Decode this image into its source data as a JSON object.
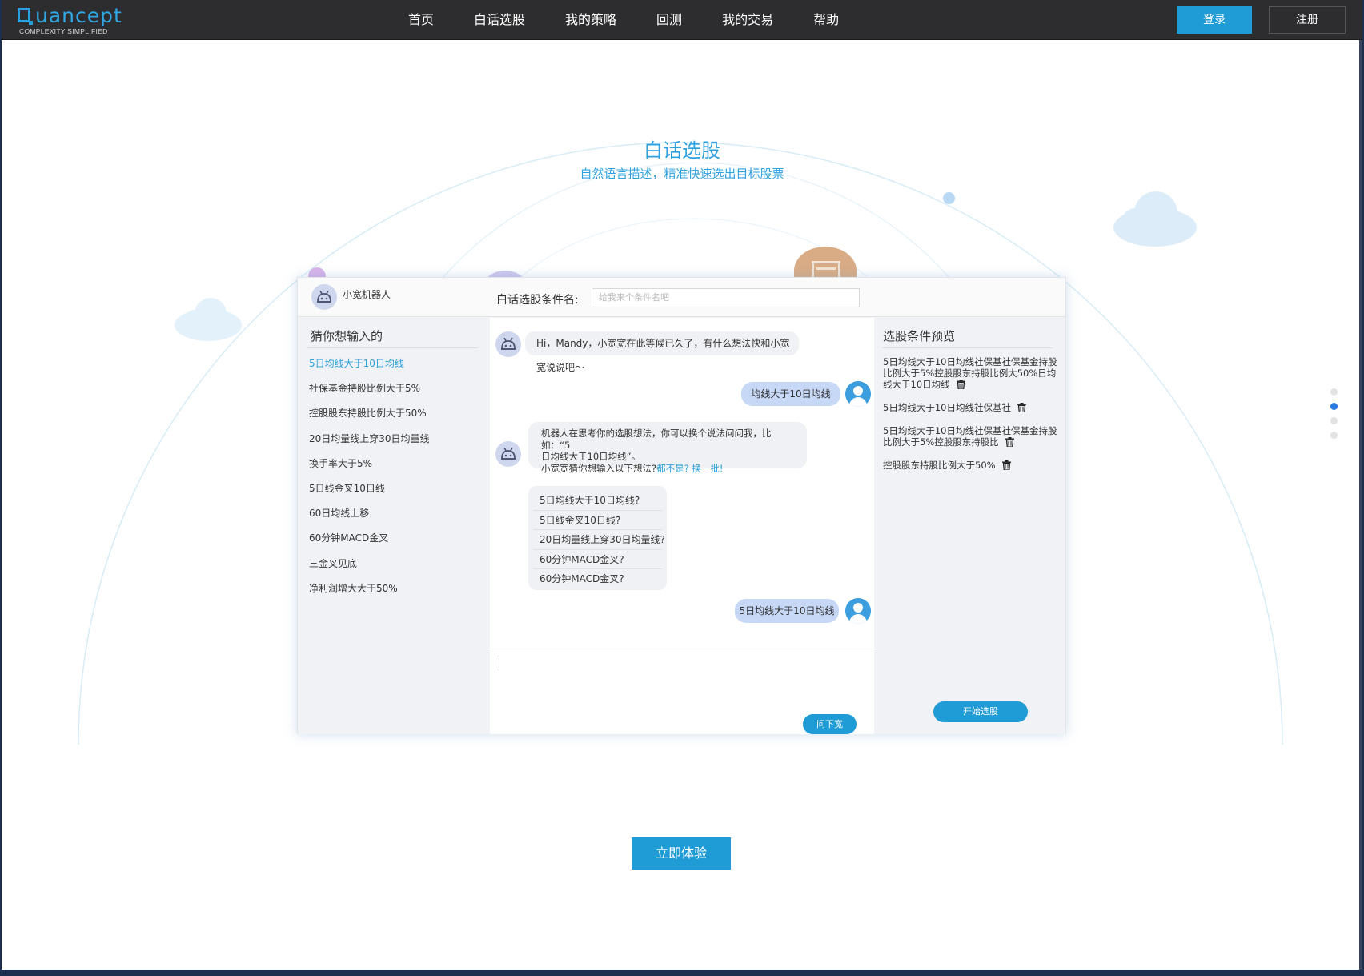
{
  "nav": {
    "logo_text": "uancept",
    "logo_sub": "COMPLEXITY SIMPLIFIED",
    "links": [
      "首页",
      "白话选股",
      "我的策略",
      "回测",
      "我的交易",
      "帮助"
    ],
    "login": "登录",
    "register": "注册"
  },
  "hero": {
    "title": "白话选股",
    "subtitle": "自然语言描述，精准快速选出目标股票"
  },
  "mock": {
    "bot_name": "小宽机器人",
    "condition_label": "白话选股条件名:",
    "condition_placeholder": "给我来个条件名吧",
    "left_title": "猜你想输入的",
    "suggestions": [
      "5日均线大于10日均线",
      "社保基金持股比例大于5%",
      "控股股东持股比例大于50%",
      "20日均量线上穿30日均量线",
      "换手率大于5%",
      "5日线金叉10日线",
      "60日均线上移",
      "60分钟MACD金叉",
      "三金叉见底",
      "净利润增大大于50%"
    ],
    "chat": {
      "greeting": "Hi，Mandy，小宽宽在此等候已久了，有什么想法快和小宽宽说说吧～",
      "user_msg_1": "均线大于10日均线",
      "bot_reply_line1": "机器人在思考你的选股想法，你可以换个说法问问我，比如：“5",
      "bot_reply_line2": "日均线大于10日均线”。",
      "bot_reply_line3": "小宽宽猜你想输入以下想法?",
      "bot_reply_link": "都不是? 换一批!",
      "options": [
        "5日均线大于10日均线?",
        "5日线金叉10日线?",
        "20日均量线上穿30日均量线?",
        "60分钟MACD金叉?",
        "60分钟MACD金叉?"
      ],
      "user_msg_2": "5日均线大于10日均线",
      "ask_button": "问下宽"
    },
    "right_title": "选股条件预览",
    "previews": [
      "5日均线大于10日均线社保基社保基金持股比例大于5%控股股东持股比例大50%日均线大于10日均线",
      "5日均线大于10日均线社保基社",
      "5日均线大于10日均线社保基社保基金持股比例大于5%控股股东持股比",
      "控股股东持股比例大于50%"
    ],
    "start_button": "开始选股"
  },
  "cta": "立即体验",
  "colors": {
    "accent": "#1f9bd6",
    "nav_bg": "#2d2d2f",
    "user_bubble": "#c6d8f6"
  }
}
